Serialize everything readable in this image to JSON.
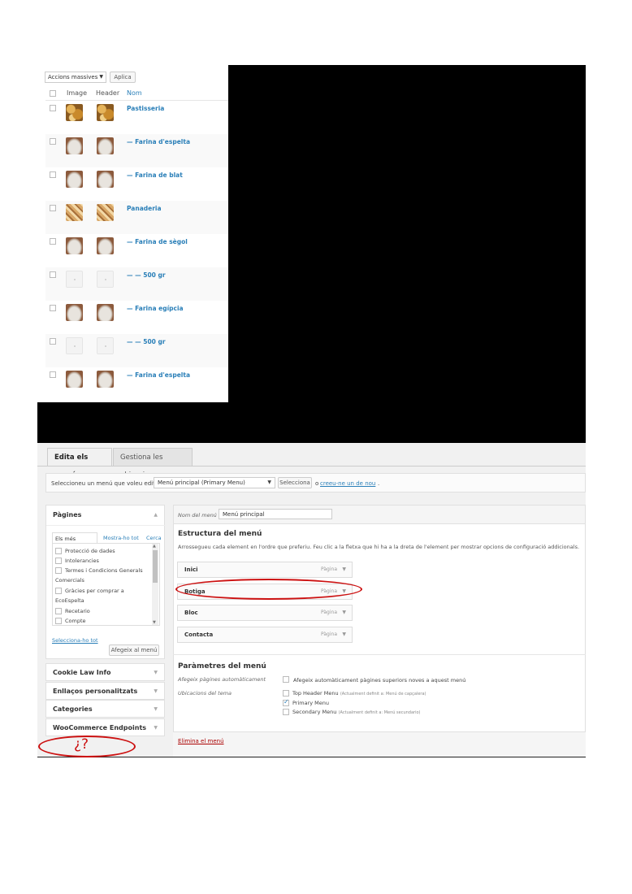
{
  "category_list": {
    "bulk_actions_label": "Accions massives",
    "apply_label": "Aplica",
    "col_image": "Image",
    "col_header": "Header",
    "col_name": "Nom",
    "rows": [
      {
        "name": "Pastisseria",
        "thumb": "pastry"
      },
      {
        "name": "— Farina d'espelta",
        "thumb": "flour"
      },
      {
        "name": "— Farina de blat",
        "thumb": "flour"
      },
      {
        "name": "Panaderia",
        "thumb": "bread"
      },
      {
        "name": "— Farina de sègol",
        "thumb": "flour"
      },
      {
        "name": "— — 500 gr",
        "thumb": "blank"
      },
      {
        "name": "— Farina egípcia",
        "thumb": "flour"
      },
      {
        "name": "— — 500 gr",
        "thumb": "blank"
      },
      {
        "name": "— Farina d'espelta",
        "thumb": "flour"
      }
    ]
  },
  "menu_editor": {
    "tab_edit": "Edita els menús",
    "tab_locations": "Gestiona les ubicacions",
    "select_prompt": "Seleccioneu un menú que voleu editar:",
    "selected_menu": "Menú principal (Primary Menu)",
    "select_button": "Selecciona",
    "or_text": "o",
    "create_new_link": "creeu-ne un de nou",
    "pages_box": {
      "title": "Pàgines",
      "tab_recent": "Els més recents",
      "tab_all": "Mostra-ho tot",
      "tab_search": "Cerca",
      "items": [
        "Protecció de dades",
        "Intolerancies",
        "Termes i Condicions Generals Comercials",
        "Gràcies per comprar a EcoEspelta",
        "Recetario",
        "Compte"
      ],
      "select_all": "Selecciona-ho tot",
      "add_button": "Afegeix al menú"
    },
    "side_sections": [
      "Cookie Law Info",
      "Enllaços personalitzats",
      "Categories",
      "WooCommerce Endpoints"
    ],
    "menu_name_label": "Nom del menú",
    "menu_name_value": "Menú principal",
    "structure_title": "Estructura del menú",
    "structure_help": "Arrossegueu cada element en l'ordre que preferiu. Feu clic a la fletxa que hi ha a la dreta de l'element per mostrar opcions de configuració addicionals.",
    "menu_items": [
      {
        "title": "Inici",
        "type": "Pàgina"
      },
      {
        "title": "Botiga",
        "type": "Pàgina"
      },
      {
        "title": "Bloc",
        "type": "Pàgina"
      },
      {
        "title": "Contacta",
        "type": "Pàgina"
      }
    ],
    "settings_title": "Paràmetres del menú",
    "auto_add_label": "Afegeix pàgines automàticament",
    "auto_add_option": "Afegeix automàticament pàgines superiors noves a aquest menú",
    "locations_label": "Ubicacions del tema",
    "locations": [
      {
        "name": "Top Header Menu",
        "note": "(Actualment definit a: Menú de capçalera)",
        "checked": false
      },
      {
        "name": "Primary Menu",
        "note": "",
        "checked": true
      },
      {
        "name": "Secondary Menu",
        "note": "(Actualment definit a: Menú secundario)",
        "checked": false
      }
    ],
    "delete_link": "Elimina el menú"
  },
  "annotation": {
    "question_text": "¿?",
    "color": "#cc1111"
  }
}
